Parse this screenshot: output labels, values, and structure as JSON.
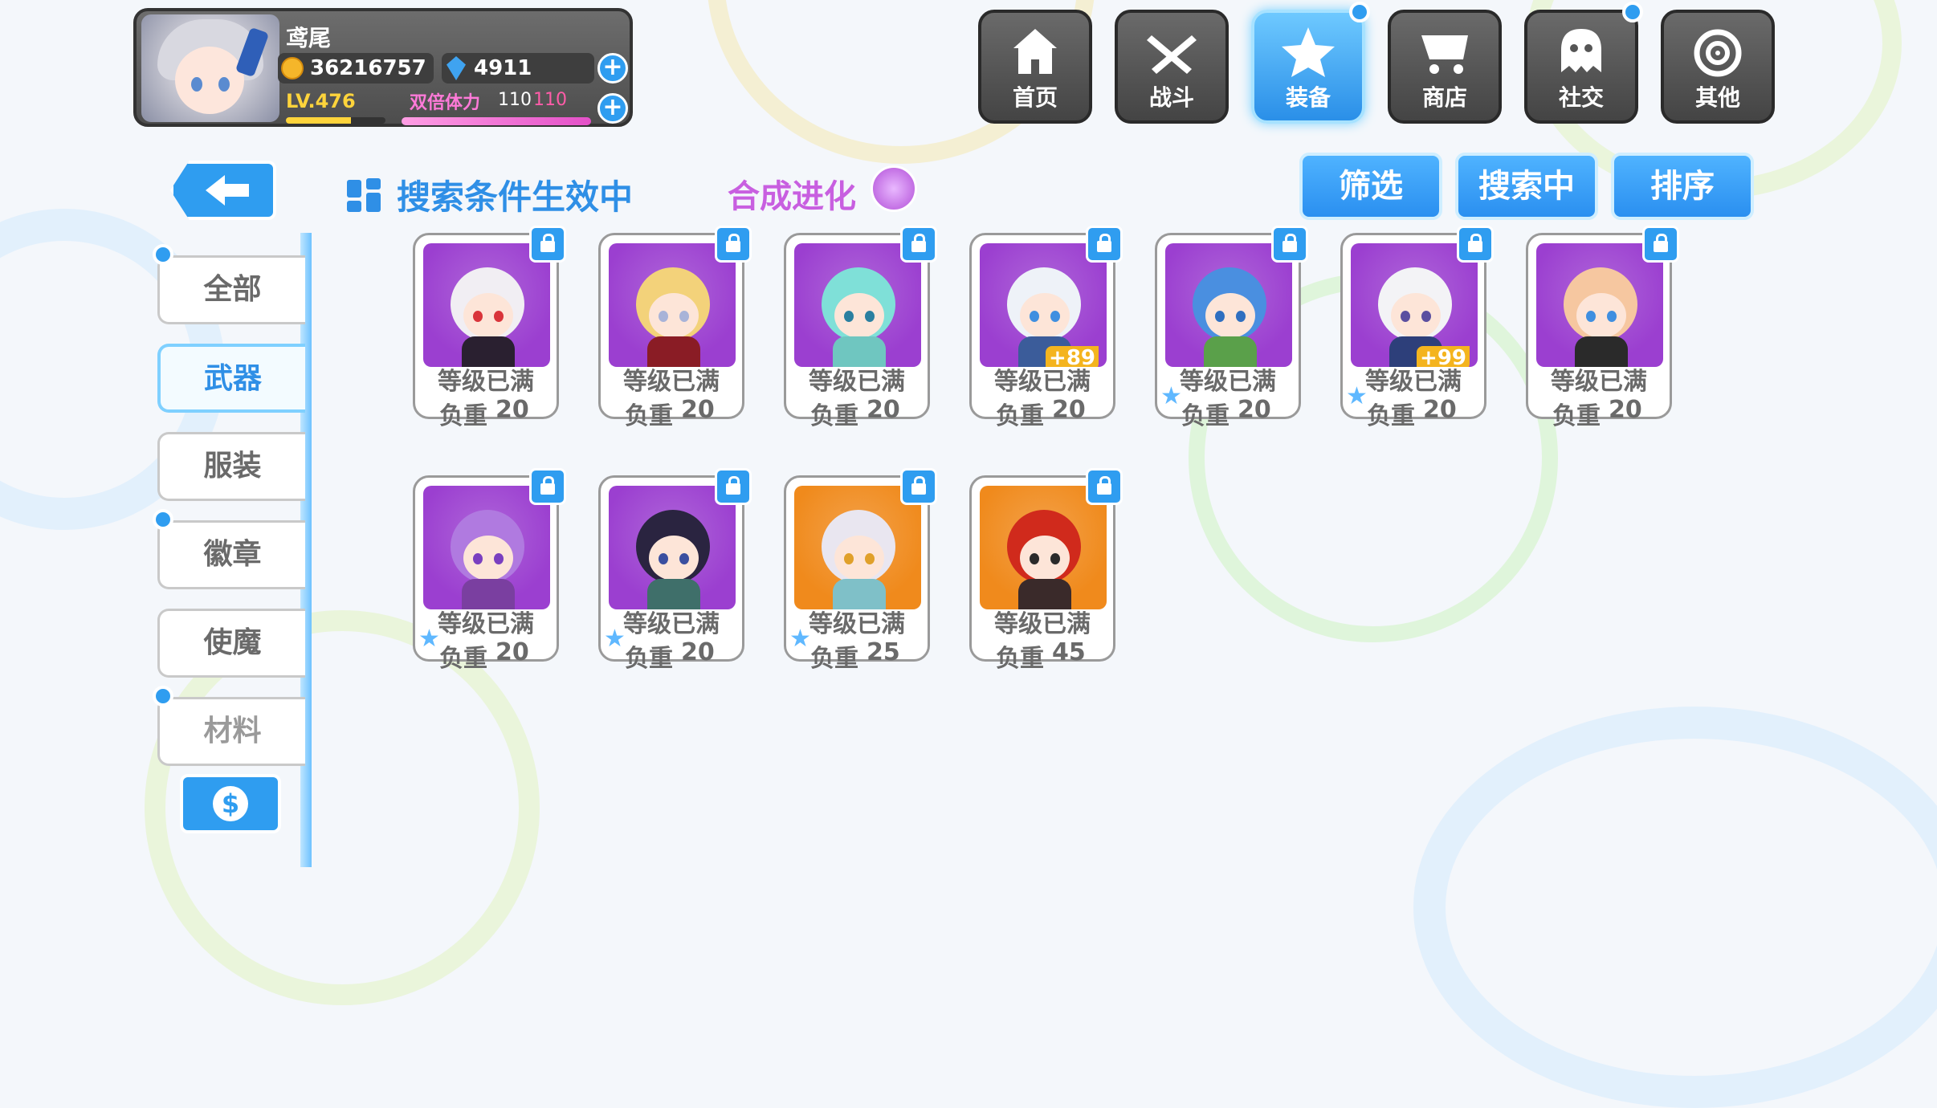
{
  "player": {
    "name": "鸢尾",
    "coins": "36216757",
    "gems": "4911",
    "level": "LV.476",
    "level_progress": 0.65,
    "stamina_label": "双倍体力",
    "stamina_current": "110",
    "stamina_max": "110",
    "stamina_progress": 1.0
  },
  "nav": [
    {
      "label": "首页",
      "icon": "house-icon",
      "active": false,
      "notify": false
    },
    {
      "label": "战斗",
      "icon": "swords-icon",
      "active": false,
      "notify": false
    },
    {
      "label": "装备",
      "icon": "star-gun-icon",
      "active": true,
      "notify": true
    },
    {
      "label": "商店",
      "icon": "cart-icon",
      "active": false,
      "notify": false
    },
    {
      "label": "社交",
      "icon": "ghost-icon",
      "active": false,
      "notify": true
    },
    {
      "label": "其他",
      "icon": "swirl-icon",
      "active": false,
      "notify": false
    }
  ],
  "header": {
    "search_status": "搜索条件生效中",
    "synthesis": "合成进化"
  },
  "actions": {
    "filter": "筛选",
    "searching": "搜索中",
    "sort": "排序"
  },
  "categories": [
    {
      "label": "全部",
      "dot": true,
      "active": false
    },
    {
      "label": "武器",
      "dot": false,
      "active": true
    },
    {
      "label": "服装",
      "dot": false,
      "active": false
    },
    {
      "label": "徽章",
      "dot": true,
      "active": false
    },
    {
      "label": "使魔",
      "dot": false,
      "active": false
    },
    {
      "label": "材料",
      "dot": true,
      "active": false
    }
  ],
  "weight_label": "负重",
  "items": [
    {
      "status": "等级已满",
      "weight": "20",
      "bonus": "",
      "bg": "#9b3fd0",
      "hair": "#f1eef3",
      "eye": "#d9343a",
      "outfit": "#2a2030",
      "star": false
    },
    {
      "status": "等级已满",
      "weight": "20",
      "bonus": "",
      "bg": "#9b3fd0",
      "hair": "#f3d27a",
      "eye": "#a8b3d8",
      "outfit": "#8a1c25",
      "star": false
    },
    {
      "status": "等级已满",
      "weight": "20",
      "bonus": "",
      "bg": "#9b3fd0",
      "hair": "#7fe0d8",
      "eye": "#2a7fa0",
      "outfit": "#6fc6c0",
      "star": false
    },
    {
      "status": "等级已满",
      "weight": "20",
      "bonus": "+89",
      "bg": "#9b3fd0",
      "hair": "#eef2f8",
      "eye": "#3f8fe0",
      "outfit": "#3b5c9a",
      "star": false
    },
    {
      "status": "等级已满",
      "weight": "20",
      "bonus": "",
      "bg": "#9b3fd0",
      "hair": "#4a8fe0",
      "eye": "#2f6fc0",
      "outfit": "#5aa04a",
      "star": true
    },
    {
      "status": "等级已满",
      "weight": "20",
      "bonus": "+99",
      "bg": "#9b3fd0",
      "hair": "#f3f3f6",
      "eye": "#5a4fa0",
      "outfit": "#2d3f7a",
      "star": true
    },
    {
      "status": "等级已满",
      "weight": "20",
      "bonus": "",
      "bg": "#9b3fd0",
      "hair": "#f6c7a0",
      "eye": "#3f8fe0",
      "outfit": "#2a2a2a",
      "star": false
    },
    {
      "status": "等级已满",
      "weight": "20",
      "bonus": "",
      "bg": "#9b3fd0",
      "hair": "#b07ae0",
      "eye": "#7a3fc0",
      "outfit": "#7a3fa0",
      "star": true
    },
    {
      "status": "等级已满",
      "weight": "20",
      "bonus": "",
      "bg": "#9b3fd0",
      "hair": "#2a2440",
      "eye": "#3a4fa0",
      "outfit": "#3f6f6a",
      "star": true
    },
    {
      "status": "等级已满",
      "weight": "25",
      "bonus": "",
      "bg": "#f08a1c",
      "hair": "#e9e6f0",
      "eye": "#e0a02a",
      "outfit": "#7fc0c8",
      "star": true
    },
    {
      "status": "等级已满",
      "weight": "45",
      "bonus": "",
      "bg": "#f08a1c",
      "hair": "#d02a1c",
      "eye": "#2a2a2a",
      "outfit": "#3a2a2a",
      "star": false
    }
  ]
}
